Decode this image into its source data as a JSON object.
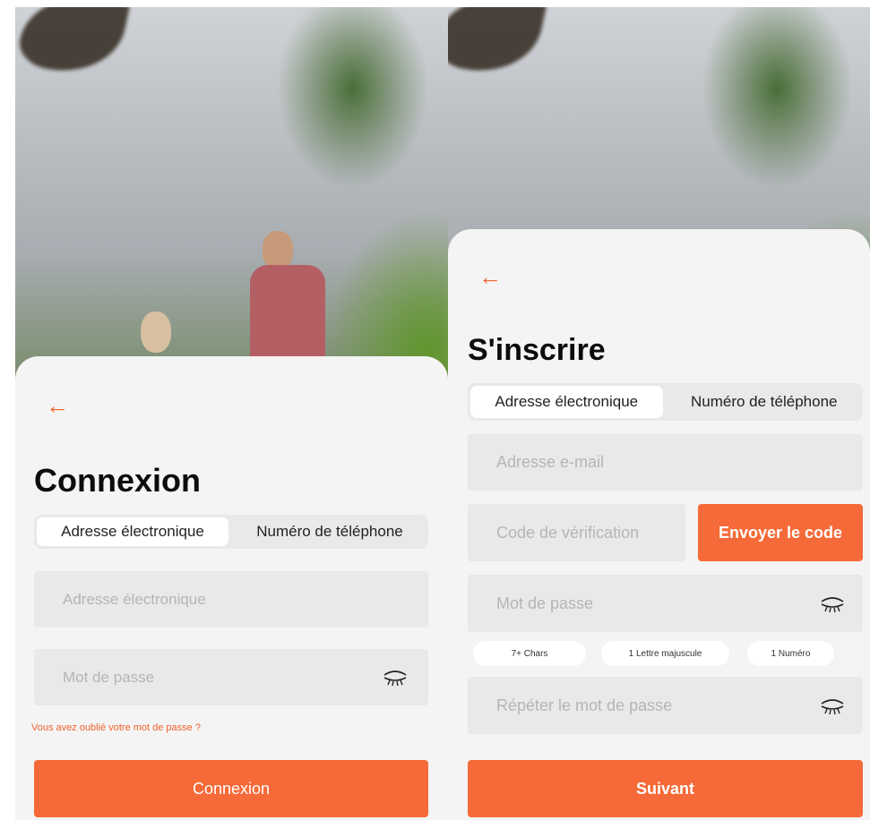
{
  "login": {
    "title": "Connexion",
    "tabs": [
      {
        "label": "Adresse électronique",
        "active": true
      },
      {
        "label": "Numéro de téléphone",
        "active": false
      }
    ],
    "email_placeholder": "Adresse électronique",
    "password_placeholder": "Mot de passe",
    "forgot_password": "Vous avez oublié votre mot de passe ?",
    "submit_label": "Connexion"
  },
  "signup": {
    "title": "S'inscrire",
    "tabs": [
      {
        "label": "Adresse électronique",
        "active": true
      },
      {
        "label": "Numéro de téléphone",
        "active": false
      }
    ],
    "email_placeholder": "Adresse e-mail",
    "code_placeholder": "Code de vérification",
    "send_code_label": "Envoyer le code",
    "password_placeholder": "Mot de passe",
    "requirements": [
      "7+ Chars",
      "1 Lettre majuscule",
      "1 Numéro"
    ],
    "repeat_password_placeholder": "Répéter le mot de passe",
    "submit_label": "Suivant"
  },
  "colors": {
    "accent": "#f56a38",
    "back_arrow": "#f0622e",
    "sheet_background": "#f4f4f4",
    "field_background": "#e9e9e9"
  },
  "icons": {
    "back": "arrow-left-icon",
    "password_visibility": "eye-closed-icon"
  }
}
